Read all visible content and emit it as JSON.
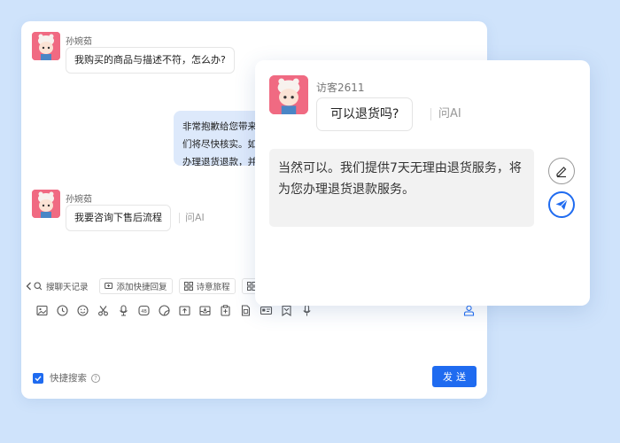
{
  "colors": {
    "background": "#cfe3fb",
    "accent": "#1f6bf0",
    "customer_bubble": "#dde9fb",
    "avatar": "#f06a82"
  },
  "chat": {
    "messages": [
      {
        "sender": "孙婉茹",
        "text": "我购买的商品与描述不符，怎么办?"
      },
      {
        "agent_lines": [
          "非常抱歉给您带来",
          "们将尽快核实。如",
          "办理退货退款，并"
        ]
      },
      {
        "sender": "孙婉茹",
        "text": "我要咨询下售后流程",
        "ask_ai": "问AI"
      }
    ]
  },
  "quick_bar": {
    "back_icon": "chevron-left-icon",
    "items": [
      {
        "icon": "search-icon",
        "label": "搜聊天记录"
      },
      {
        "icon": "add-reply-icon",
        "label": "添加快捷回复"
      },
      {
        "icon": "grid-icon",
        "label": "诗意旅程"
      }
    ]
  },
  "toolbar": {
    "icons": [
      "image-icon",
      "clock-icon",
      "emoji-icon",
      "scissors-icon",
      "voice-icon",
      "sticker-icon",
      "gif-icon",
      "folder-icon",
      "inbox-icon",
      "clipboard-icon",
      "document-icon",
      "card-icon",
      "bookmark-icon",
      "microphone-icon"
    ],
    "right_icon": "person-icon"
  },
  "footer": {
    "quick_search_label": "快捷搜索",
    "quick_search_checked": true,
    "send_label": "发送"
  },
  "popup": {
    "visitor_name": "访客2611",
    "question": "可以退货吗?",
    "ask_ai": "问AI",
    "answer": "当然可以。我们提供7天无理由退货服务，将为您办理退货退款服务。",
    "edit_icon": "edit-icon",
    "send_icon": "paper-plane-icon"
  }
}
